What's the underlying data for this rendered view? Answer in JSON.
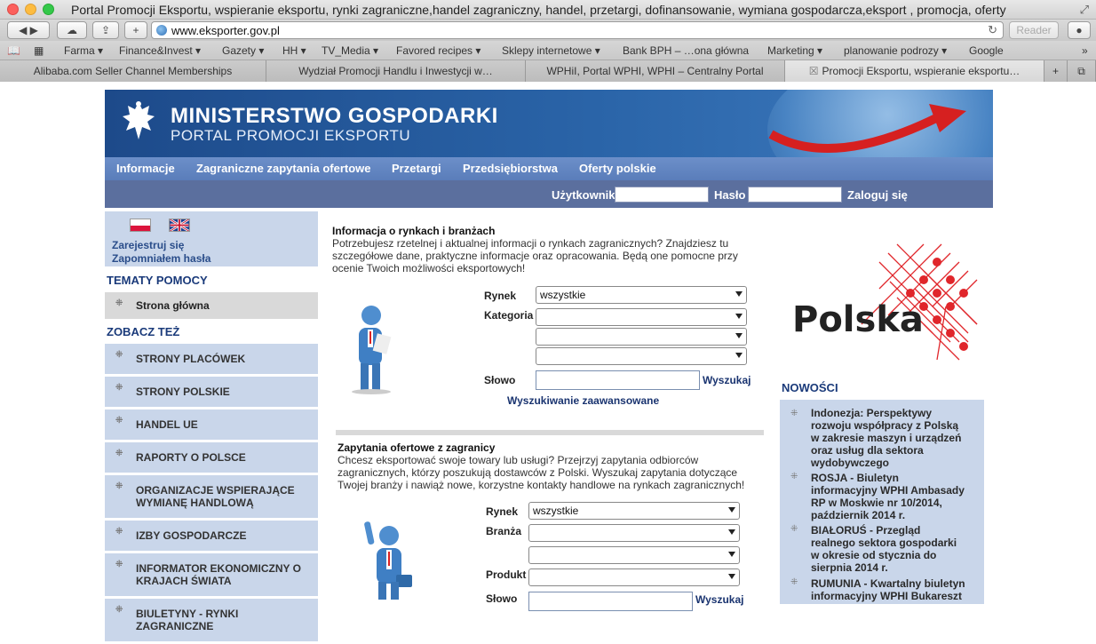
{
  "window": {
    "title": "Portal Promocji Eksportu, wspieranie eksportu, rynki zagraniczne,handel zagraniczny, handel, przetargi, dofinansowanie, wymiana gospodarcza,eksport , promocja, oferty"
  },
  "toolbar": {
    "url": "www.eksporter.gov.pl",
    "reader_label": "Reader"
  },
  "bookmarks": [
    "Farma ▾",
    "Finance&Invest ▾",
    "Gazety ▾",
    "HH ▾",
    "TV_Media ▾",
    "Favored recipes ▾",
    "Sklepy internetowe ▾",
    "Bank BPH – …ona główna",
    "Marketing ▾",
    "planowanie podrozy ▾",
    "Google"
  ],
  "tabs": [
    "Alibaba.com Seller Channel Memberships",
    "Wydział Promocji Handlu i Inwestycji w…",
    "WPHiI, Portal WPHI, WPHI – Centralny Portal",
    "Promocji Eksportu, wspieranie eksportu…"
  ],
  "banner": {
    "title": "MINISTERSTWO GOSPODARKI",
    "subtitle": "PORTAL PROMOCJI EKSPORTU"
  },
  "nav": [
    "Informacje",
    "Zagraniczne zapytania ofertowe",
    "Przetargi",
    "Przedsiębiorstwa",
    "Oferty polskie"
  ],
  "login": {
    "user_label": "Użytkownik",
    "pass_label": "Hasło",
    "submit_label": "Zaloguj się"
  },
  "left": {
    "register": "Zarejestruj się",
    "forgot": "Zapomniałem hasła",
    "help_heading": "TEMATY POMOCY",
    "home": "Strona główna",
    "see_also_heading": "ZOBACZ TEŻ",
    "items": [
      "STRONY PLACÓWEK",
      "STRONY POLSKIE",
      "HANDEL UE",
      "RAPORTY O POLSCE",
      "ORGANIZACJE WSPIERAJĄCE WYMIANĘ HANDLOWĄ",
      "IZBY GOSPODARCZE",
      "INFORMATOR EKONOMICZNY O KRAJACH ŚWIATA",
      "BIULETYNY - RYNKI ZAGRANICZNE"
    ]
  },
  "info": {
    "heading": "Informacja o rynkach i branżach",
    "text": "Potrzebujesz rzetelnej i aktualnej informacji o rynkach zagranicznych? Znajdziesz tu szczegółowe dane, praktyczne informacje oraz opracowania. Będą one pomocne przy ocenie Twoich możliwości eksportowych!",
    "market_label": "Rynek",
    "market_value": "wszystkie",
    "category_label": "Kategoria",
    "word_label": "Słowo",
    "search_label": "Wyszukaj",
    "advanced_label": "Wyszukiwanie zaawansowane"
  },
  "offers": {
    "heading": "Zapytania ofertowe z zagranicy",
    "text": "Chcesz eksportować swoje towary lub usługi? Przejrzyj zapytania odbiorców zagranicznych, którzy poszukują dostawców z Polski. Wyszukaj zapytania dotyczące Twojej branży i nawiąż nowe, korzystne kontakty handlowe na rynkach zagranicznych!",
    "market_label": "Rynek",
    "market_value": "wszystkie",
    "branch_label": "Branża",
    "product_label": "Produkt",
    "word_label": "Słowo",
    "search_label": "Wyszukaj"
  },
  "right": {
    "logo_text": "Polska",
    "news_heading": "NOWOŚCI",
    "news": [
      "Indonezja: Perspektywy rozwoju współpracy z Polską w zakresie maszyn i urządzeń oraz usług dla sektora wydobywczego",
      "ROSJA - Biuletyn informacyjny WPHI Ambasady RP w Moskwie nr 10/2014, październik 2014 r.",
      "BIAŁORUŚ - Przegląd realnego sektora gospodarki w okresie od stycznia do sierpnia 2014 r.",
      "RUMUNIA - Kwartalny biuletyn informacyjny WPHI Bukareszt"
    ]
  },
  "colors": {
    "banner": "#2a64a8",
    "nav": "#6c8fc9",
    "loginbar": "#5b6f9e",
    "sidebar": "#c9d6ea",
    "heading": "#1a3a7a",
    "logo_red": "#e0262b"
  }
}
